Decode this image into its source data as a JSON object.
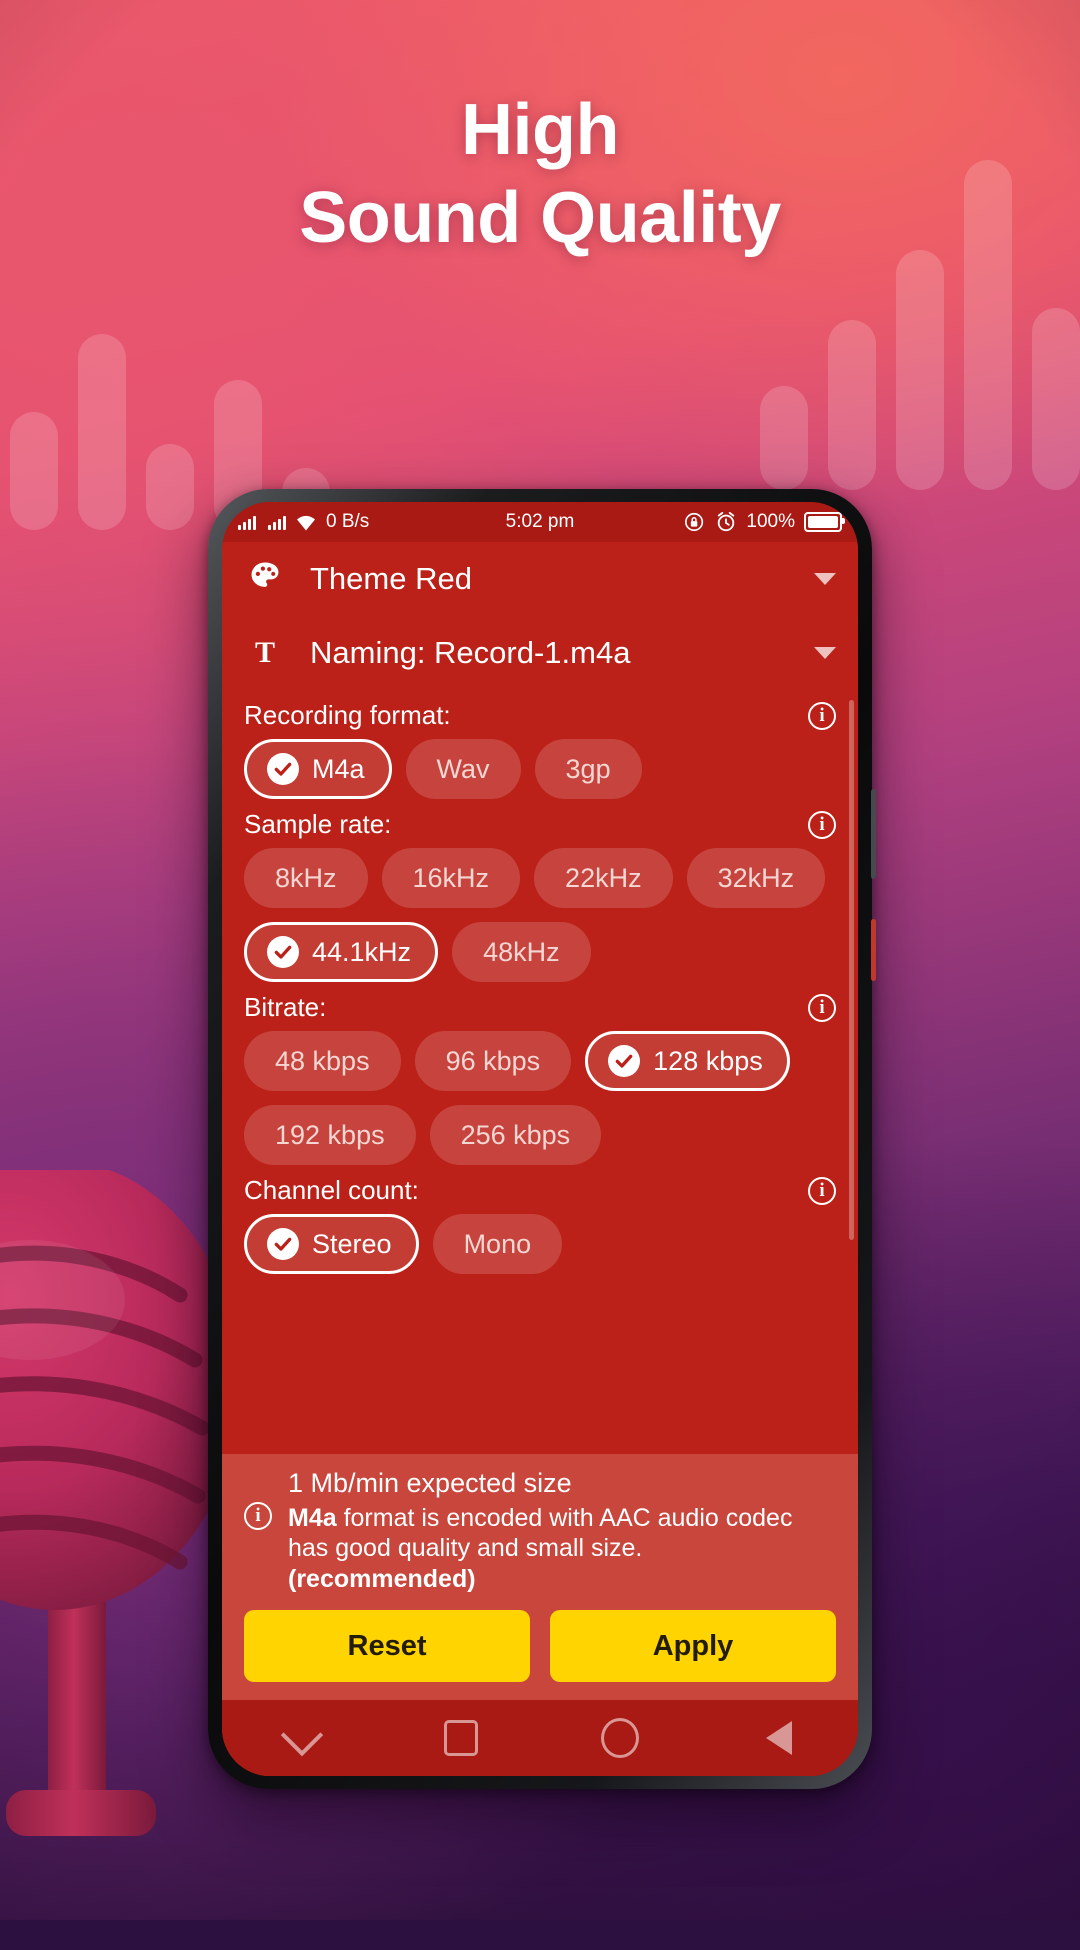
{
  "promo": {
    "headline_line1": "High",
    "headline_line2": "Sound Quality",
    "accent_yellow": "#ffd400",
    "theme_red": "#bb2118"
  },
  "statusbar": {
    "network_speed": "0 B/s",
    "time": "5:02 pm",
    "battery_percent": "100%",
    "icons": [
      "signal-icon",
      "wifi-icon",
      "rotation-lock-icon",
      "alarm-icon",
      "battery-icon"
    ]
  },
  "header": {
    "theme_label": "Theme Red",
    "theme_icon": "palette-icon",
    "naming_label": "Naming: Record-1.m4a",
    "naming_icon": "text-format-icon"
  },
  "sections": [
    {
      "title": "Recording format:",
      "options": [
        {
          "label": "M4a",
          "selected": true
        },
        {
          "label": "Wav",
          "selected": false
        },
        {
          "label": "3gp",
          "selected": false
        }
      ]
    },
    {
      "title": "Sample rate:",
      "options": [
        {
          "label": "8kHz",
          "selected": false
        },
        {
          "label": "16kHz",
          "selected": false
        },
        {
          "label": "22kHz",
          "selected": false
        },
        {
          "label": "32kHz",
          "selected": false
        },
        {
          "label": "44.1kHz",
          "selected": true
        },
        {
          "label": "48kHz",
          "selected": false
        }
      ]
    },
    {
      "title": "Bitrate:",
      "options": [
        {
          "label": "48 kbps",
          "selected": false
        },
        {
          "label": "96 kbps",
          "selected": false
        },
        {
          "label": "128 kbps",
          "selected": true
        },
        {
          "label": "192 kbps",
          "selected": false
        },
        {
          "label": "256 kbps",
          "selected": false
        }
      ]
    },
    {
      "title": "Channel count:",
      "options": [
        {
          "label": "Stereo",
          "selected": true
        },
        {
          "label": "Mono",
          "selected": false
        }
      ]
    }
  ],
  "info": {
    "expected_size": "1 Mb/min expected size",
    "description_strong": "M4a",
    "description_text": " format is encoded with AAC audio codec has good quality and small size. ",
    "description_recommended": "(recommended)"
  },
  "actions": {
    "reset_label": "Reset",
    "apply_label": "Apply"
  },
  "navbar": {
    "items": [
      "chevron-down-icon",
      "recents-square-icon",
      "home-circle-icon",
      "back-triangle-icon"
    ]
  }
}
